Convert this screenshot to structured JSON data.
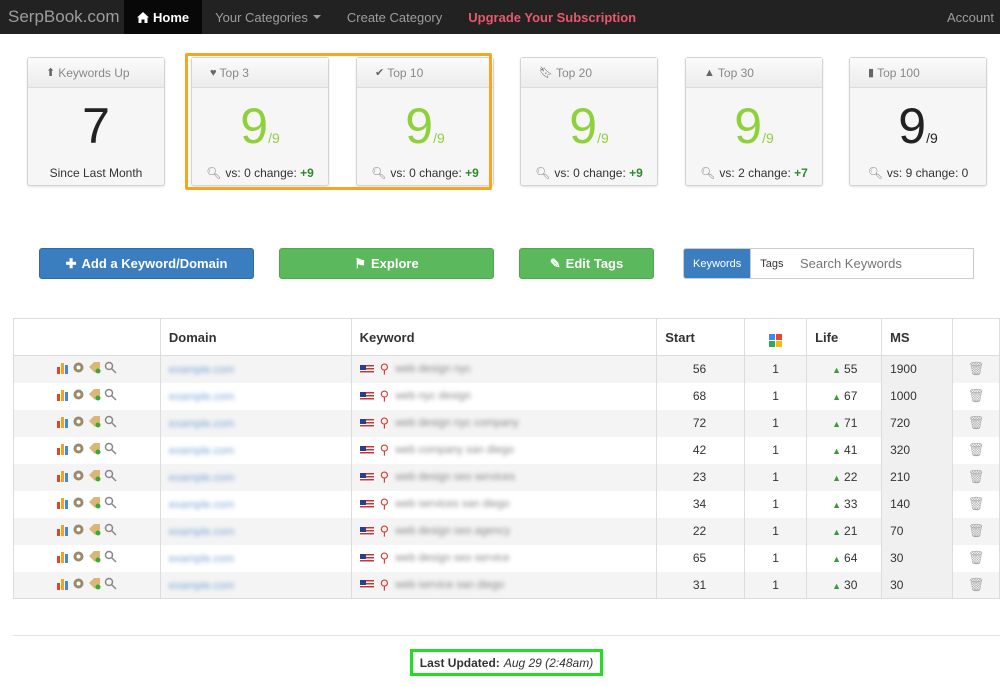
{
  "nav": {
    "brand": "SerpBook.com",
    "home": "Home",
    "categories": "Your Categories",
    "create": "Create Category",
    "upgrade": "Upgrade Your Subscription",
    "account": "Account"
  },
  "cards": [
    {
      "head": "Keywords Up",
      "icon": "arrow-up-icon",
      "value": "7",
      "denominator": "",
      "sub": "Since Last Month",
      "color": "dark"
    },
    {
      "head": "Top 3",
      "icon": "heart-icon",
      "value": "9",
      "denominator": "/9",
      "sub_vs": "vs: 0 change:",
      "sub_change": "+9",
      "color": "green"
    },
    {
      "head": "Top 10",
      "icon": "check-icon",
      "value": "9",
      "denominator": "/9",
      "sub_vs": "vs: 0 change:",
      "sub_change": "+9",
      "color": "green"
    },
    {
      "head": "Top 20",
      "icon": "bookmark-icon",
      "value": "9",
      "denominator": "/9",
      "sub_vs": "vs: 0 change:",
      "sub_change": "+9",
      "color": "green"
    },
    {
      "head": "Top 30",
      "icon": "road-icon",
      "value": "9",
      "denominator": "/9",
      "sub_vs": "vs: 2 change:",
      "sub_change": "+7",
      "color": "green"
    },
    {
      "head": "Top 100",
      "icon": "signal-icon",
      "value": "9",
      "denominator": "/9",
      "sub_vs": "vs: 9 change: 0",
      "sub_change": "",
      "color": "dark"
    }
  ],
  "buttons": {
    "add": "Add a Keyword/Domain",
    "explore": "Explore",
    "edit_tags": "Edit Tags",
    "toggle_keywords": "Keywords",
    "toggle_tags": "Tags",
    "search_placeholder": "Search Keywords"
  },
  "table": {
    "headers": [
      "",
      "Domain",
      "Keyword",
      "Start",
      "",
      "Life",
      "MS",
      ""
    ],
    "rows": [
      {
        "domain": "example.com",
        "keyword": "web design nyc",
        "start": "56",
        "rank": "1",
        "life": "55",
        "ms": "1900"
      },
      {
        "domain": "example.com",
        "keyword": "web nyc design",
        "start": "68",
        "rank": "1",
        "life": "67",
        "ms": "1000"
      },
      {
        "domain": "example.com",
        "keyword": "web design nyc company",
        "start": "72",
        "rank": "1",
        "life": "71",
        "ms": "720"
      },
      {
        "domain": "example.com",
        "keyword": "web company san diego",
        "start": "42",
        "rank": "1",
        "life": "41",
        "ms": "320"
      },
      {
        "domain": "example.com",
        "keyword": "web design seo services",
        "start": "23",
        "rank": "1",
        "life": "22",
        "ms": "210"
      },
      {
        "domain": "example.com",
        "keyword": "web services san diego",
        "start": "34",
        "rank": "1",
        "life": "33",
        "ms": "140"
      },
      {
        "domain": "example.com",
        "keyword": "web design seo agency",
        "start": "22",
        "rank": "1",
        "life": "21",
        "ms": "70"
      },
      {
        "domain": "example.com",
        "keyword": "web design seo service",
        "start": "65",
        "rank": "1",
        "life": "64",
        "ms": "30"
      },
      {
        "domain": "example.com",
        "keyword": "web service san diego",
        "start": "31",
        "rank": "1",
        "life": "30",
        "ms": "30"
      }
    ]
  },
  "footer": {
    "label": "Last Updated:",
    "value": "Aug 29 (2:48am)"
  }
}
